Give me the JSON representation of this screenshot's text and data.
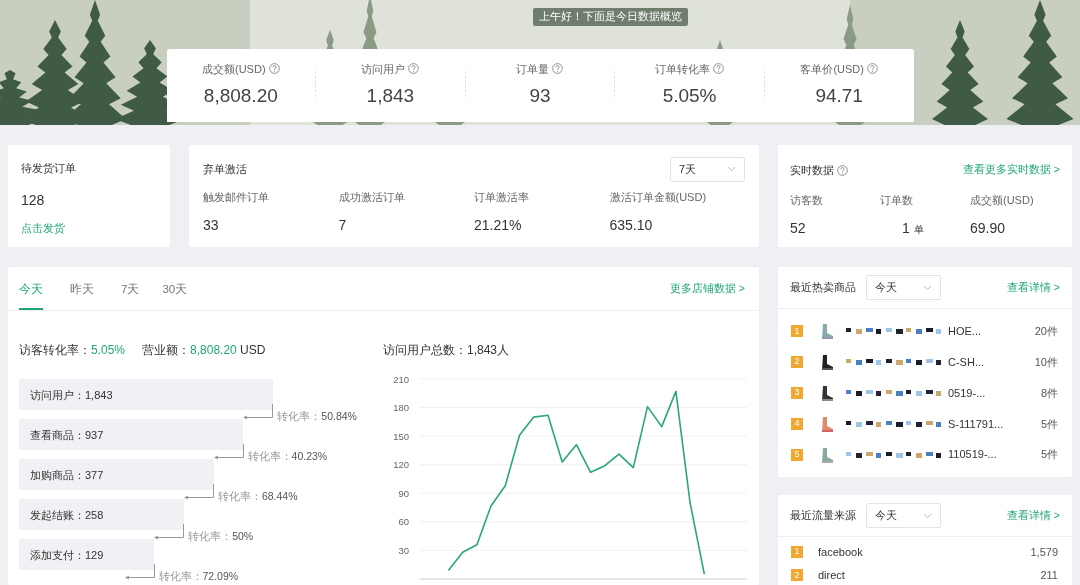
{
  "greeting": "上午好！下面是今日数据概览",
  "overview": [
    {
      "label": "成交额(USD)",
      "value": "8,808.20"
    },
    {
      "label": "访问用户",
      "value": "1,843"
    },
    {
      "label": "订单量",
      "value": "93"
    },
    {
      "label": "订单转化率",
      "value": "5.05%"
    },
    {
      "label": "客单价(USD)",
      "value": "94.71"
    }
  ],
  "pending_orders": {
    "title": "待发货订单",
    "count": "128",
    "action": "点击发货"
  },
  "abandoned_cart": {
    "title": "弃单激活",
    "period": "7天",
    "metrics": [
      {
        "label": "触发邮件订单",
        "value": "33"
      },
      {
        "label": "成功激活订单",
        "value": "7"
      },
      {
        "label": "订单激活率",
        "value": "21.21%"
      },
      {
        "label": "激活订单金额(USD)",
        "value": "635.10"
      }
    ]
  },
  "realtime": {
    "title": "实时数据",
    "link": "查看更多实时数据 >",
    "metrics": [
      {
        "label": "访客数",
        "value": "52"
      },
      {
        "label": "订单数",
        "value": "1",
        "unit": "单"
      },
      {
        "label": "成交额(USD)",
        "value": "69.90"
      }
    ]
  },
  "store": {
    "tabs": [
      {
        "label": "今天",
        "selected": true
      },
      {
        "label": "昨天",
        "selected": false
      },
      {
        "label": "7天",
        "selected": false
      },
      {
        "label": "30天",
        "selected": false
      }
    ],
    "link": "更多店铺数据 >",
    "summary": [
      {
        "label": "访客转化率：",
        "value": "5.05%"
      },
      {
        "label": "营业额：",
        "value": "8,808.20",
        "unit": "USD"
      }
    ],
    "funnel": [
      {
        "label": "访问用户：1,843"
      },
      {
        "label": "查看商品：937"
      },
      {
        "label": "加购商品：377"
      },
      {
        "label": "发起结账：258"
      },
      {
        "label": "添加支付：129"
      }
    ],
    "conversions": [
      {
        "label": "转化率：",
        "value": "50.84%"
      },
      {
        "label": "转化率：",
        "value": "40.23%"
      },
      {
        "label": "转化率：",
        "value": "68.44%"
      },
      {
        "label": "转化率：",
        "value": "50%"
      },
      {
        "label": "转化率：",
        "value": "72.09%"
      }
    ],
    "chart_title": "访问用户总数：1,843人",
    "chart_data": {
      "type": "line",
      "ylim": [
        0,
        210
      ],
      "yticks": [
        30,
        60,
        90,
        120,
        150,
        180,
        210
      ],
      "grid": true,
      "series": [
        {
          "color": "#2aa57e",
          "values": [
            null,
            null,
            9,
            28,
            36,
            77,
            98,
            151,
            170,
            172,
            123,
            141,
            112,
            119,
            131,
            117,
            181,
            160,
            197,
            80,
            5,
            null,
            null,
            null
          ]
        }
      ]
    }
  },
  "hot_products": {
    "title": "最近热卖商品",
    "period": "今天",
    "link": "查看详情 >",
    "items": [
      {
        "rank": "1",
        "name": "HOE...",
        "sold": "20件"
      },
      {
        "rank": "2",
        "name": "C-SH...",
        "sold": "10件"
      },
      {
        "rank": "3",
        "name": "0519-...",
        "sold": "8件"
      },
      {
        "rank": "4",
        "name": "S-111791...",
        "sold": "5件"
      },
      {
        "rank": "5",
        "name": "110519-...",
        "sold": "5件"
      }
    ]
  },
  "traffic_sources": {
    "title": "最近流量来源",
    "period": "今天",
    "link": "查看详情 >",
    "items": [
      {
        "rank": "1",
        "source": "facebook",
        "visits": "1,579"
      },
      {
        "rank": "2",
        "source": "direct",
        "visits": "211"
      }
    ]
  }
}
